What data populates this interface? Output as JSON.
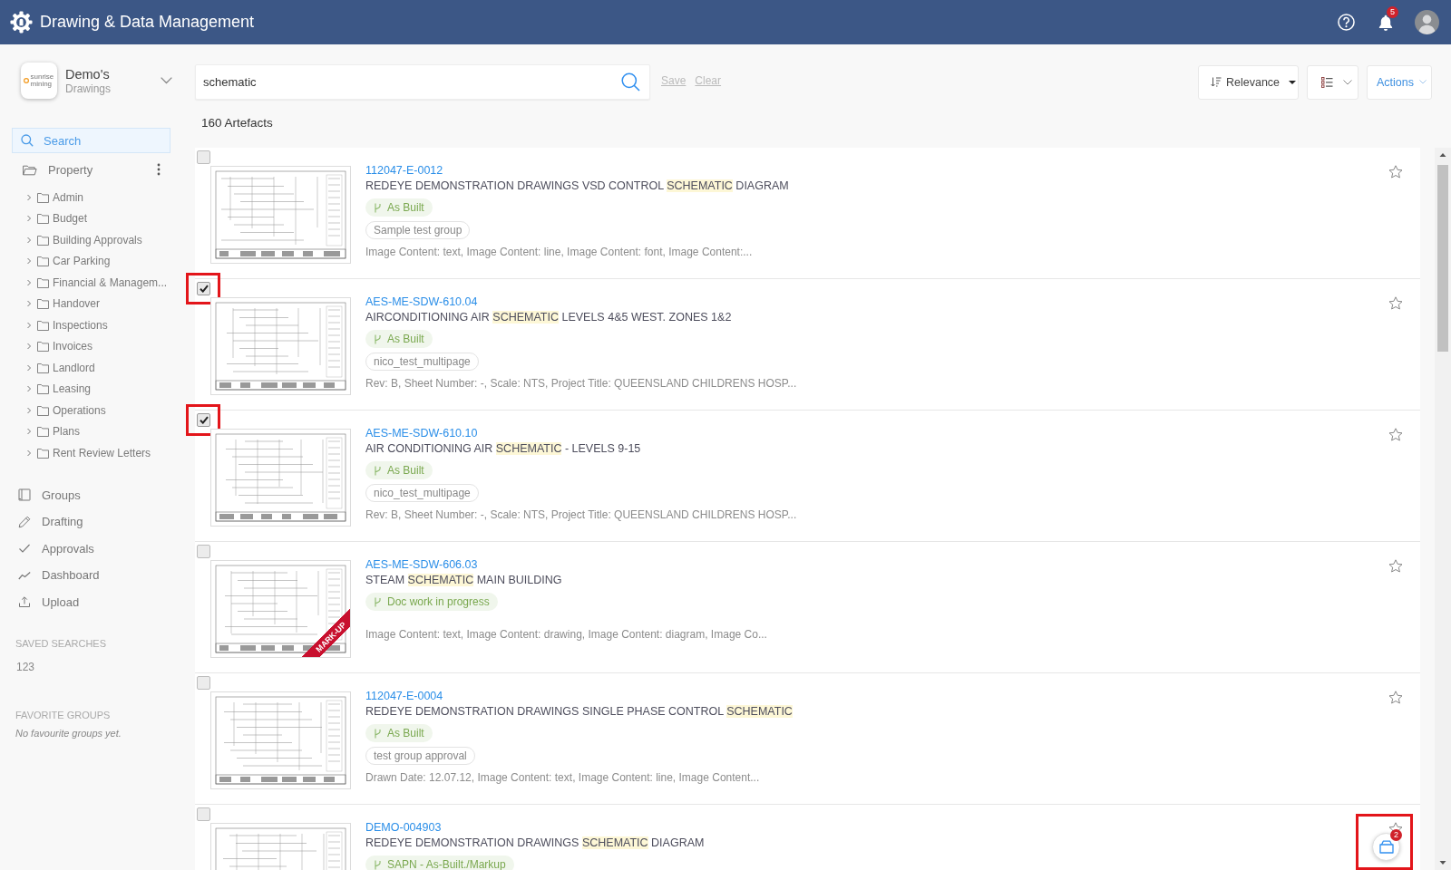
{
  "header": {
    "title": "Drawing & Data Management",
    "notifications": "5"
  },
  "workspace": {
    "brand": "sunrise mining",
    "name": "Demo's",
    "subtitle": "Drawings"
  },
  "sidebar": {
    "search_item": {
      "label": "Search",
      "selected": true
    },
    "tree": {
      "label": "Property",
      "expanded": true,
      "children": [
        {
          "label": "Admin",
          "expanded": false
        },
        {
          "label": "Budget",
          "expanded": false
        },
        {
          "label": "Building Approvals",
          "expanded": false
        },
        {
          "label": "Car Parking",
          "expanded": false
        },
        {
          "label": "Financial & Managem...",
          "expanded": false
        },
        {
          "label": "Handover",
          "expanded": false
        },
        {
          "label": "Inspections",
          "expanded": false
        },
        {
          "label": "Invoices",
          "expanded": false
        },
        {
          "label": "Landlord",
          "expanded": false
        },
        {
          "label": "Leasing",
          "expanded": false
        },
        {
          "label": "Operations",
          "expanded": false
        },
        {
          "label": "Plans",
          "expanded": false
        },
        {
          "label": "Rent Review Letters",
          "expanded": false
        }
      ]
    },
    "nav": [
      {
        "label": "Groups",
        "selected": false
      },
      {
        "label": "Drafting",
        "selected": false
      },
      {
        "label": "Approvals",
        "selected": false
      },
      {
        "label": "Dashboard",
        "selected": false
      },
      {
        "label": "Upload",
        "selected": false
      }
    ],
    "saved_searches": {
      "heading": "SAVED SEARCHES",
      "items": [
        "123"
      ]
    },
    "favorite_groups": {
      "heading": "FAVORITE GROUPS",
      "empty": "No favourite groups yet."
    }
  },
  "toolbar": {
    "query": "schematic",
    "save": {
      "label": "Save",
      "disabled": true
    },
    "clear": {
      "label": "Clear",
      "disabled": true
    },
    "sort": "Relevance",
    "actions": "Actions",
    "count": "160 Artefacts"
  },
  "results": [
    {
      "id": "112047-E-0012",
      "title": [
        {
          "text": "REDEYE DEMONSTRATION DRAWINGS VSD CONTROL ",
          "match": false
        },
        {
          "text": "SCHEMATIC",
          "match": true
        },
        {
          "text": " DIAGRAM",
          "match": false
        }
      ],
      "status": "As Built",
      "group": "Sample test group",
      "meta": "Image Content: text, Image Content: line, Image Content: font, Image Content:...",
      "checked": false,
      "favorite": false,
      "annotated": false
    },
    {
      "id": "AES-ME-SDW-610.04",
      "title": [
        {
          "text": "AIRCONDITIONING AIR ",
          "match": false
        },
        {
          "text": "SCHEMATIC",
          "match": true
        },
        {
          "text": " LEVELS 4&5 WEST. ZONES 1&2",
          "match": false
        }
      ],
      "status": "As Built",
      "group": "nico_test_multipage",
      "meta": "Rev: B, Sheet Number: -, Scale: NTS, Project Title: QUEENSLAND CHILDRENS HOSP...",
      "checked": true,
      "favorite": false,
      "annotated": true
    },
    {
      "id": "AES-ME-SDW-610.10",
      "title": [
        {
          "text": "AIR CONDITIONING AIR ",
          "match": false
        },
        {
          "text": "SCHEMATIC",
          "match": true
        },
        {
          "text": " - LEVELS 9-15",
          "match": false
        }
      ],
      "status": "As Built",
      "group": "nico_test_multipage",
      "meta": "Rev: B, Sheet Number: -, Scale: NTS, Project Title: QUEENSLAND CHILDRENS HOSP...",
      "checked": true,
      "favorite": false,
      "annotated": true
    },
    {
      "id": "AES-ME-SDW-606.03",
      "title": [
        {
          "text": "STEAM ",
          "match": false
        },
        {
          "text": "SCHEMATIC",
          "match": true
        },
        {
          "text": " MAIN BUILDING",
          "match": false
        }
      ],
      "status": "Doc work in progress",
      "meta": "Image Content: text, Image Content: drawing, Image Content: diagram, Image Co...",
      "ribbon": "MARK-UP",
      "checked": false,
      "favorite": false,
      "annotated": false
    },
    {
      "id": "112047-E-0004",
      "title": [
        {
          "text": "REDEYE DEMONSTRATION DRAWINGS SINGLE PHASE CONTROL ",
          "match": false
        },
        {
          "text": "SCHEMATIC",
          "match": true
        }
      ],
      "status": "As Built",
      "group": "test group approval",
      "meta": "Drawn Date: 12.07.12, Image Content: text, Image Content: line, Image Content...",
      "checked": false,
      "favorite": false,
      "annotated": false
    },
    {
      "id": "DEMO-004903",
      "title": [
        {
          "text": "REDEYE DEMONSTRATION DRAWINGS ",
          "match": false
        },
        {
          "text": "SCHEMATIC",
          "match": true
        },
        {
          "text": " DIAGRAM",
          "match": false
        }
      ],
      "status": "SAPN - As-Built./Markup",
      "checked": false,
      "favorite": false,
      "annotated": false
    }
  ],
  "basket": {
    "count": "2",
    "annotated": true
  }
}
